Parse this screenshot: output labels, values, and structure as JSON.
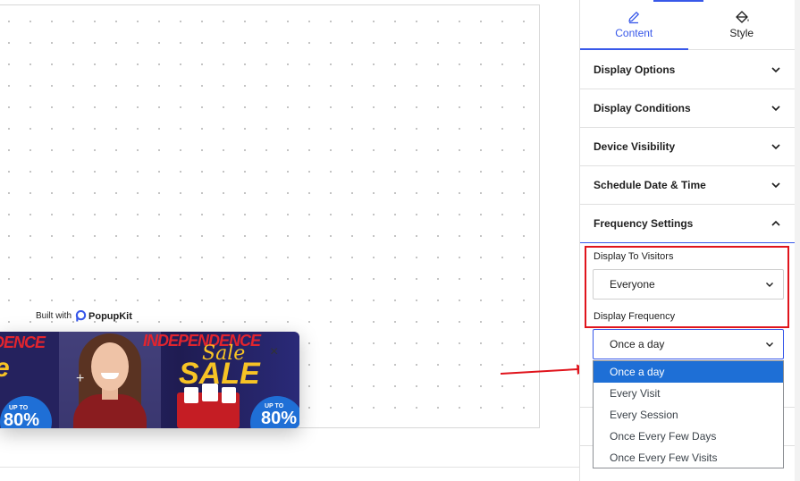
{
  "canvas": {
    "built_with_label": "Built with",
    "brand_name": "PopupKit",
    "popup_preview": {
      "headline": "INDEPENDENCE",
      "script_word": "Sale",
      "big_word": "SALE",
      "badge_small": "UP TO",
      "badge_big": "80%",
      "left_headline": "DENCE",
      "left_big": "e",
      "close_symbol": "×",
      "plus_symbol": "+"
    }
  },
  "panel": {
    "tabs": [
      {
        "label": "Content",
        "icon": "pencil-icon",
        "active": true
      },
      {
        "label": "Style",
        "icon": "paint-bucket-icon",
        "active": false
      }
    ],
    "sections": [
      {
        "label": "Display Options",
        "expanded": false
      },
      {
        "label": "Display Conditions",
        "expanded": false
      },
      {
        "label": "Device Visibility",
        "expanded": false
      },
      {
        "label": "Schedule Date & Time",
        "expanded": false
      },
      {
        "label": "Frequency Settings",
        "expanded": true
      }
    ],
    "frequency": {
      "visitors_label": "Display To Visitors",
      "visitors_value": "Everyone",
      "frequency_label": "Display Frequency",
      "frequency_value": "Once a day",
      "options": [
        "Once a day",
        "Every Visit",
        "Every Session",
        "Once Every Few Days",
        "Once Every Few Visits"
      ],
      "selected_option": "Once a day"
    }
  },
  "colors": {
    "accent": "#3858e9",
    "highlight": "#e0141c",
    "selected_option": "#1e6fd6"
  }
}
